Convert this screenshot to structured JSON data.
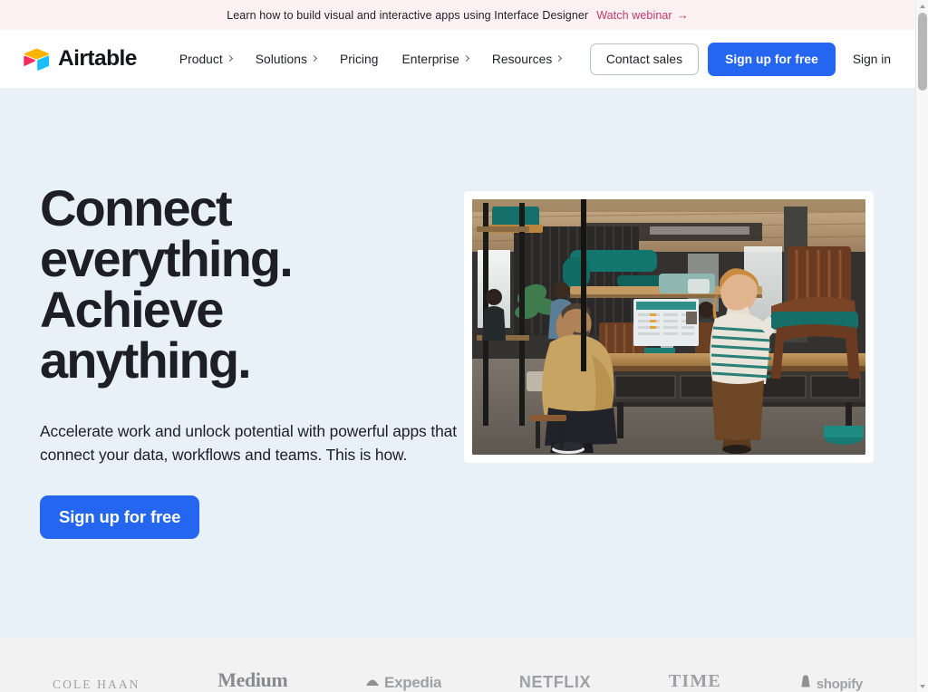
{
  "promo": {
    "text": "Learn how to build visual and interactive apps using Interface Designer",
    "link_label": "Watch webinar",
    "arrow": "→",
    "background": "#fdf1f3",
    "link_color": "#c2386b"
  },
  "nav": {
    "brand": "Airtable",
    "items": [
      {
        "label": "Product",
        "has_chevron": true
      },
      {
        "label": "Solutions",
        "has_chevron": true
      },
      {
        "label": "Pricing",
        "has_chevron": false
      },
      {
        "label": "Enterprise",
        "has_chevron": true
      },
      {
        "label": "Resources",
        "has_chevron": true
      }
    ],
    "contact_sales": "Contact sales",
    "signup": "Sign up for free",
    "signin": "Sign in",
    "primary_color": "#2566f0"
  },
  "hero": {
    "title_line1": "Connect",
    "title_line2": "everything.",
    "title_line3": "Achieve",
    "title_line4": "anything.",
    "subtitle": "Accelerate work and unlock potential with powerful apps that connect your data, workflows and teams. This is how.",
    "cta_label": "Sign up for free",
    "background": "#e9f1f8",
    "image_alt": "Team collaborating around a workbench with a desktop computer in an industrial studio"
  },
  "logos": [
    {
      "name": "COLE HAAN",
      "style": "cole"
    },
    {
      "name": "Medium",
      "style": "medium"
    },
    {
      "name": "Expedia",
      "style": "expedia"
    },
    {
      "name": "NETFLIX",
      "style": "netflix"
    },
    {
      "name": "TIME",
      "style": "time"
    },
    {
      "name": "shopify",
      "style": "shopify"
    }
  ]
}
